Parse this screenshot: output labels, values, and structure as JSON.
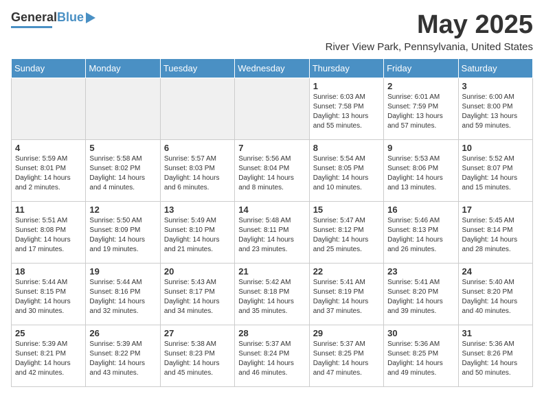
{
  "header": {
    "logo_general": "General",
    "logo_blue": "Blue",
    "month_title": "May 2025",
    "location": "River View Park, Pennsylvania, United States"
  },
  "days_of_week": [
    "Sunday",
    "Monday",
    "Tuesday",
    "Wednesday",
    "Thursday",
    "Friday",
    "Saturday"
  ],
  "weeks": [
    [
      {
        "day": "",
        "info": ""
      },
      {
        "day": "",
        "info": ""
      },
      {
        "day": "",
        "info": ""
      },
      {
        "day": "",
        "info": ""
      },
      {
        "day": "1",
        "info": "Sunrise: 6:03 AM\nSunset: 7:58 PM\nDaylight: 13 hours\nand 55 minutes."
      },
      {
        "day": "2",
        "info": "Sunrise: 6:01 AM\nSunset: 7:59 PM\nDaylight: 13 hours\nand 57 minutes."
      },
      {
        "day": "3",
        "info": "Sunrise: 6:00 AM\nSunset: 8:00 PM\nDaylight: 13 hours\nand 59 minutes."
      }
    ],
    [
      {
        "day": "4",
        "info": "Sunrise: 5:59 AM\nSunset: 8:01 PM\nDaylight: 14 hours\nand 2 minutes."
      },
      {
        "day": "5",
        "info": "Sunrise: 5:58 AM\nSunset: 8:02 PM\nDaylight: 14 hours\nand 4 minutes."
      },
      {
        "day": "6",
        "info": "Sunrise: 5:57 AM\nSunset: 8:03 PM\nDaylight: 14 hours\nand 6 minutes."
      },
      {
        "day": "7",
        "info": "Sunrise: 5:56 AM\nSunset: 8:04 PM\nDaylight: 14 hours\nand 8 minutes."
      },
      {
        "day": "8",
        "info": "Sunrise: 5:54 AM\nSunset: 8:05 PM\nDaylight: 14 hours\nand 10 minutes."
      },
      {
        "day": "9",
        "info": "Sunrise: 5:53 AM\nSunset: 8:06 PM\nDaylight: 14 hours\nand 13 minutes."
      },
      {
        "day": "10",
        "info": "Sunrise: 5:52 AM\nSunset: 8:07 PM\nDaylight: 14 hours\nand 15 minutes."
      }
    ],
    [
      {
        "day": "11",
        "info": "Sunrise: 5:51 AM\nSunset: 8:08 PM\nDaylight: 14 hours\nand 17 minutes."
      },
      {
        "day": "12",
        "info": "Sunrise: 5:50 AM\nSunset: 8:09 PM\nDaylight: 14 hours\nand 19 minutes."
      },
      {
        "day": "13",
        "info": "Sunrise: 5:49 AM\nSunset: 8:10 PM\nDaylight: 14 hours\nand 21 minutes."
      },
      {
        "day": "14",
        "info": "Sunrise: 5:48 AM\nSunset: 8:11 PM\nDaylight: 14 hours\nand 23 minutes."
      },
      {
        "day": "15",
        "info": "Sunrise: 5:47 AM\nSunset: 8:12 PM\nDaylight: 14 hours\nand 25 minutes."
      },
      {
        "day": "16",
        "info": "Sunrise: 5:46 AM\nSunset: 8:13 PM\nDaylight: 14 hours\nand 26 minutes."
      },
      {
        "day": "17",
        "info": "Sunrise: 5:45 AM\nSunset: 8:14 PM\nDaylight: 14 hours\nand 28 minutes."
      }
    ],
    [
      {
        "day": "18",
        "info": "Sunrise: 5:44 AM\nSunset: 8:15 PM\nDaylight: 14 hours\nand 30 minutes."
      },
      {
        "day": "19",
        "info": "Sunrise: 5:44 AM\nSunset: 8:16 PM\nDaylight: 14 hours\nand 32 minutes."
      },
      {
        "day": "20",
        "info": "Sunrise: 5:43 AM\nSunset: 8:17 PM\nDaylight: 14 hours\nand 34 minutes."
      },
      {
        "day": "21",
        "info": "Sunrise: 5:42 AM\nSunset: 8:18 PM\nDaylight: 14 hours\nand 35 minutes."
      },
      {
        "day": "22",
        "info": "Sunrise: 5:41 AM\nSunset: 8:19 PM\nDaylight: 14 hours\nand 37 minutes."
      },
      {
        "day": "23",
        "info": "Sunrise: 5:41 AM\nSunset: 8:20 PM\nDaylight: 14 hours\nand 39 minutes."
      },
      {
        "day": "24",
        "info": "Sunrise: 5:40 AM\nSunset: 8:20 PM\nDaylight: 14 hours\nand 40 minutes."
      }
    ],
    [
      {
        "day": "25",
        "info": "Sunrise: 5:39 AM\nSunset: 8:21 PM\nDaylight: 14 hours\nand 42 minutes."
      },
      {
        "day": "26",
        "info": "Sunrise: 5:39 AM\nSunset: 8:22 PM\nDaylight: 14 hours\nand 43 minutes."
      },
      {
        "day": "27",
        "info": "Sunrise: 5:38 AM\nSunset: 8:23 PM\nDaylight: 14 hours\nand 45 minutes."
      },
      {
        "day": "28",
        "info": "Sunrise: 5:37 AM\nSunset: 8:24 PM\nDaylight: 14 hours\nand 46 minutes."
      },
      {
        "day": "29",
        "info": "Sunrise: 5:37 AM\nSunset: 8:25 PM\nDaylight: 14 hours\nand 47 minutes."
      },
      {
        "day": "30",
        "info": "Sunrise: 5:36 AM\nSunset: 8:25 PM\nDaylight: 14 hours\nand 49 minutes."
      },
      {
        "day": "31",
        "info": "Sunrise: 5:36 AM\nSunset: 8:26 PM\nDaylight: 14 hours\nand 50 minutes."
      }
    ]
  ]
}
